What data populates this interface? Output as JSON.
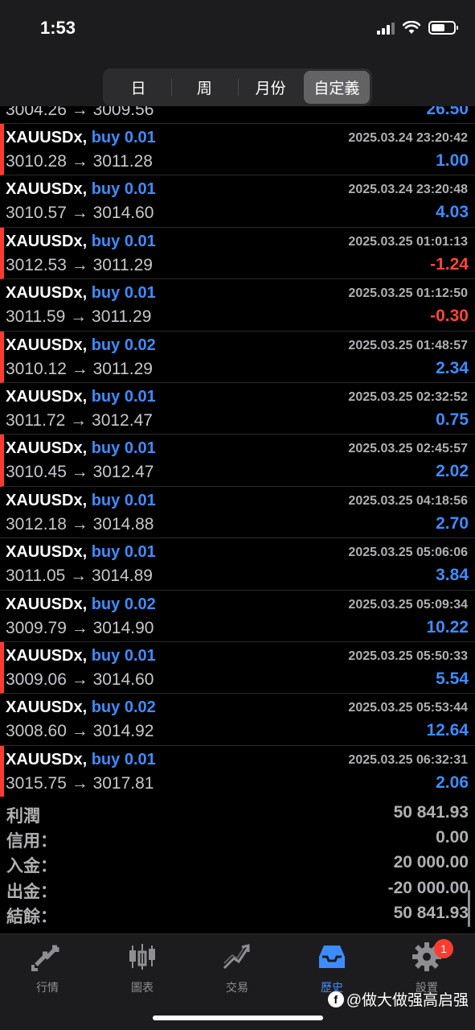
{
  "status": {
    "time": "1:53"
  },
  "period_tabs": [
    {
      "label": "日",
      "active": false
    },
    {
      "label": "周",
      "active": false
    },
    {
      "label": "月份",
      "active": false
    },
    {
      "label": "自定義",
      "active": true
    }
  ],
  "partial_row": {
    "prices": "3004.26 → 3009.56",
    "profit": "26.50"
  },
  "deals": [
    {
      "symbol": "XAUUSDx,",
      "side": "buy 0.01",
      "time": "2025.03.24 23:20:42",
      "prices": "3010.28 → 3011.28",
      "profit": "1.00",
      "negative": false,
      "marked": true
    },
    {
      "symbol": "XAUUSDx,",
      "side": "buy 0.01",
      "time": "2025.03.24 23:20:48",
      "prices": "3010.57 → 3014.60",
      "profit": "4.03",
      "negative": false,
      "marked": false
    },
    {
      "symbol": "XAUUSDx,",
      "side": "buy 0.01",
      "time": "2025.03.25 01:01:13",
      "prices": "3012.53 → 3011.29",
      "profit": "-1.24",
      "negative": true,
      "marked": true
    },
    {
      "symbol": "XAUUSDx,",
      "side": "buy 0.01",
      "time": "2025.03.25 01:12:50",
      "prices": "3011.59 → 3011.29",
      "profit": "-0.30",
      "negative": true,
      "marked": false
    },
    {
      "symbol": "XAUUSDx,",
      "side": "buy 0.02",
      "time": "2025.03.25 01:48:57",
      "prices": "3010.12 → 3011.29",
      "profit": "2.34",
      "negative": false,
      "marked": true
    },
    {
      "symbol": "XAUUSDx,",
      "side": "buy 0.01",
      "time": "2025.03.25 02:32:52",
      "prices": "3011.72 → 3012.47",
      "profit": "0.75",
      "negative": false,
      "marked": false
    },
    {
      "symbol": "XAUUSDx,",
      "side": "buy 0.01",
      "time": "2025.03.25 02:45:57",
      "prices": "3010.45 → 3012.47",
      "profit": "2.02",
      "negative": false,
      "marked": true
    },
    {
      "symbol": "XAUUSDx,",
      "side": "buy 0.01",
      "time": "2025.03.25 04:18:56",
      "prices": "3012.18 → 3014.88",
      "profit": "2.70",
      "negative": false,
      "marked": false
    },
    {
      "symbol": "XAUUSDx,",
      "side": "buy 0.01",
      "time": "2025.03.25 05:06:06",
      "prices": "3011.05 → 3014.89",
      "profit": "3.84",
      "negative": false,
      "marked": false
    },
    {
      "symbol": "XAUUSDx,",
      "side": "buy 0.02",
      "time": "2025.03.25 05:09:34",
      "prices": "3009.79 → 3014.90",
      "profit": "10.22",
      "negative": false,
      "marked": false
    },
    {
      "symbol": "XAUUSDx,",
      "side": "buy 0.01",
      "time": "2025.03.25 05:50:33",
      "prices": "3009.06 → 3014.60",
      "profit": "5.54",
      "negative": false,
      "marked": true
    },
    {
      "symbol": "XAUUSDx,",
      "side": "buy 0.02",
      "time": "2025.03.25 05:53:44",
      "prices": "3008.60 → 3014.92",
      "profit": "12.64",
      "negative": false,
      "marked": false
    },
    {
      "symbol": "XAUUSDx,",
      "side": "buy 0.01",
      "time": "2025.03.25 06:32:31",
      "prices": "3015.75 → 3017.81",
      "profit": "2.06",
      "negative": false,
      "marked": true
    }
  ],
  "summary": [
    {
      "label": "利潤",
      "value": "50 841.93"
    },
    {
      "label": "信用：",
      "value": "0.00"
    },
    {
      "label": "入金：",
      "value": "20 000.00"
    },
    {
      "label": "出金：",
      "value": "-20 000.00"
    },
    {
      "label": "結餘：",
      "value": "50 841.93"
    }
  ],
  "tabs": [
    {
      "label": "行情",
      "icon": "quotes-arrows-icon",
      "active": false
    },
    {
      "label": "圖表",
      "icon": "candlestick-chart-icon",
      "active": false
    },
    {
      "label": "交易",
      "icon": "trade-trend-icon",
      "active": false
    },
    {
      "label": "歷史",
      "icon": "history-inbox-icon",
      "active": true
    },
    {
      "label": "設置",
      "icon": "gear-icon",
      "active": false,
      "badge": "1"
    }
  ],
  "watermark": {
    "text": "@做大做强高启强",
    "logo": "f"
  },
  "colors": {
    "accent": "#3d8cff",
    "negative": "#ff453a",
    "marker": "#ff3b30",
    "background": "#000000",
    "bar": "#1c1c1e"
  }
}
